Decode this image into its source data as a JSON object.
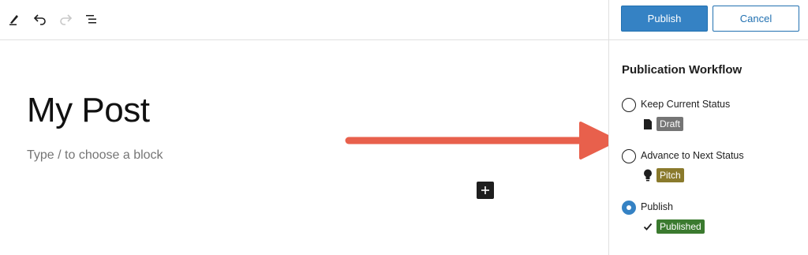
{
  "toolbar": {
    "tools": [
      {
        "icon": "pen-icon",
        "label": "Edit"
      },
      {
        "icon": "undo-icon",
        "label": "Undo"
      },
      {
        "icon": "redo-icon",
        "label": "Redo"
      },
      {
        "icon": "list-view-icon",
        "label": "Document overview"
      }
    ]
  },
  "editor": {
    "post_title": "My Post",
    "block_placeholder": "Type / to choose a block",
    "inserter_icon": "plus-icon"
  },
  "sidebar": {
    "publish_label": "Publish",
    "cancel_label": "Cancel",
    "panel_title": "Publication Workflow",
    "options": [
      {
        "label": "Keep Current Status",
        "status": "Draft",
        "status_icon": "document-icon",
        "badge_color": "#757575",
        "checked": false
      },
      {
        "label": "Advance to Next Status",
        "status": "Pitch",
        "status_icon": "lightbulb-icon",
        "badge_color": "#8a7a2c",
        "checked": false
      },
      {
        "label": "Publish",
        "status": "Published",
        "status_icon": "checkmark-icon",
        "badge_color": "#3b7a2f",
        "checked": true
      }
    ]
  },
  "colors": {
    "accent": "#3582c4",
    "annotation_arrow": "#e8604c"
  }
}
